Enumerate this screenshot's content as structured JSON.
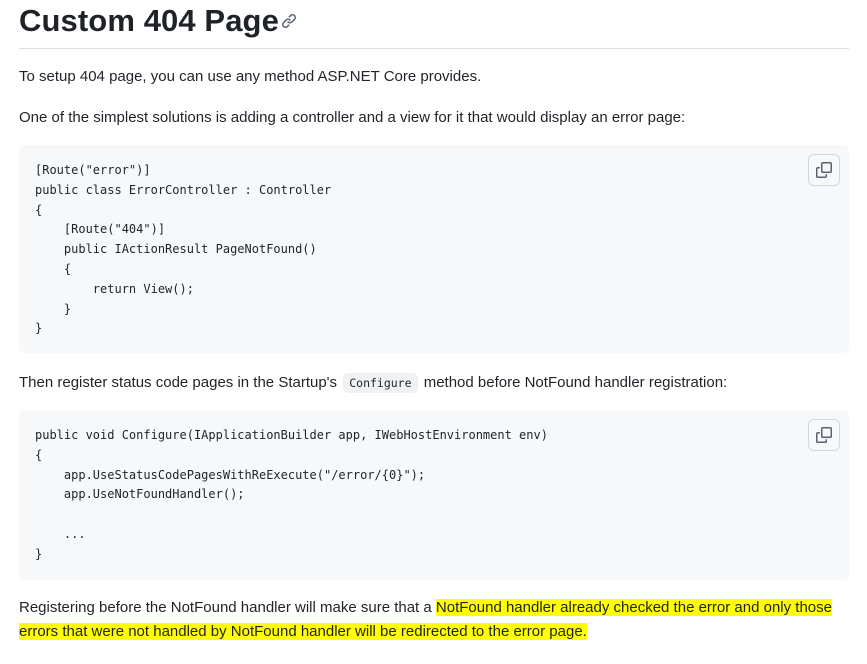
{
  "heading": {
    "title": "Custom 404 Page",
    "anchor_icon": "link-icon"
  },
  "paragraphs": {
    "intro": "To setup 404 page, you can use any method ASP.NET Core provides.",
    "controller": "One of the simplest solutions is adding a controller and a view for it that would display an error page:",
    "register_before": "Then register status code pages in the Startup's",
    "register_code": "Configure",
    "register_after": "method before NotFound handler registration:",
    "final_plain": "Registering before the NotFound handler will make sure that a ",
    "final_highlight": "NotFound handler already checked the error and only those errors that were not handled by NotFound handler will be redirected to the error page."
  },
  "code_blocks": [
    {
      "code": "[Route(\"error\")]\npublic class ErrorController : Controller\n{\n    [Route(\"404\")]\n    public IActionResult PageNotFound()\n    {\n        return View();\n    }\n}",
      "copy_icon": "copy-icon"
    },
    {
      "code": "public void Configure(IApplicationBuilder app, IWebHostEnvironment env)\n{\n    app.UseStatusCodePagesWithReExecute(\"/error/{0}\");\n    app.UseNotFoundHandler();\n\n    ...\n}",
      "copy_icon": "copy-icon"
    }
  ],
  "colors": {
    "text": "#1f2328",
    "code_background": "#f6f8fa",
    "highlight": "#ffff00",
    "divider": "#d8dee4"
  }
}
